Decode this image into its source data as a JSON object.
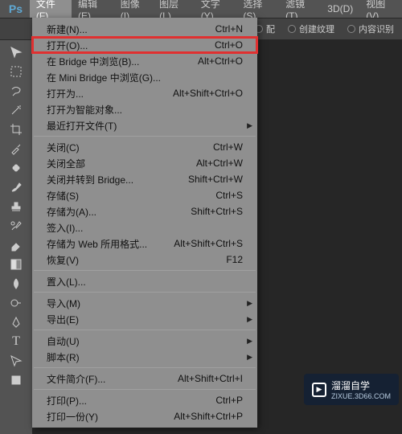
{
  "menubar": {
    "logo": "Ps",
    "items": [
      "文件(F)",
      "编辑(E)",
      "图像(I)",
      "图层(L)",
      "文字(Y)",
      "选择(S)",
      "滤镜(T)",
      "3D(D)",
      "视图(V)"
    ]
  },
  "optionsbar": {
    "r1": "配",
    "r2": "创建纹理",
    "r3": "内容识别"
  },
  "dropdown": {
    "items": [
      {
        "label": "新建(N)...",
        "shortcut": "Ctrl+N"
      },
      {
        "label": "打开(O)...",
        "shortcut": "Ctrl+O",
        "highlight": true
      },
      {
        "label": "在 Bridge 中浏览(B)...",
        "shortcut": "Alt+Ctrl+O"
      },
      {
        "label": "在 Mini Bridge 中浏览(G)..."
      },
      {
        "label": "打开为...",
        "shortcut": "Alt+Shift+Ctrl+O"
      },
      {
        "label": "打开为智能对象..."
      },
      {
        "label": "最近打开文件(T)",
        "submenu": true
      },
      {
        "sep": true
      },
      {
        "label": "关闭(C)",
        "shortcut": "Ctrl+W"
      },
      {
        "label": "关闭全部",
        "shortcut": "Alt+Ctrl+W"
      },
      {
        "label": "关闭并转到 Bridge...",
        "shortcut": "Shift+Ctrl+W"
      },
      {
        "label": "存储(S)",
        "shortcut": "Ctrl+S"
      },
      {
        "label": "存储为(A)...",
        "shortcut": "Shift+Ctrl+S"
      },
      {
        "label": "签入(I)..."
      },
      {
        "label": "存储为 Web 所用格式...",
        "shortcut": "Alt+Shift+Ctrl+S"
      },
      {
        "label": "恢复(V)",
        "shortcut": "F12"
      },
      {
        "sep": true
      },
      {
        "label": "置入(L)..."
      },
      {
        "sep": true
      },
      {
        "label": "导入(M)",
        "submenu": true
      },
      {
        "label": "导出(E)",
        "submenu": true
      },
      {
        "sep": true
      },
      {
        "label": "自动(U)",
        "submenu": true
      },
      {
        "label": "脚本(R)",
        "submenu": true
      },
      {
        "sep": true
      },
      {
        "label": "文件简介(F)...",
        "shortcut": "Alt+Shift+Ctrl+I"
      },
      {
        "sep": true
      },
      {
        "label": "打印(P)...",
        "shortcut": "Ctrl+P"
      },
      {
        "label": "打印一份(Y)",
        "shortcut": "Alt+Shift+Ctrl+P"
      }
    ]
  },
  "watermark": {
    "title": "溜溜自学",
    "sub": "ZIXUE.3D66.COM"
  }
}
